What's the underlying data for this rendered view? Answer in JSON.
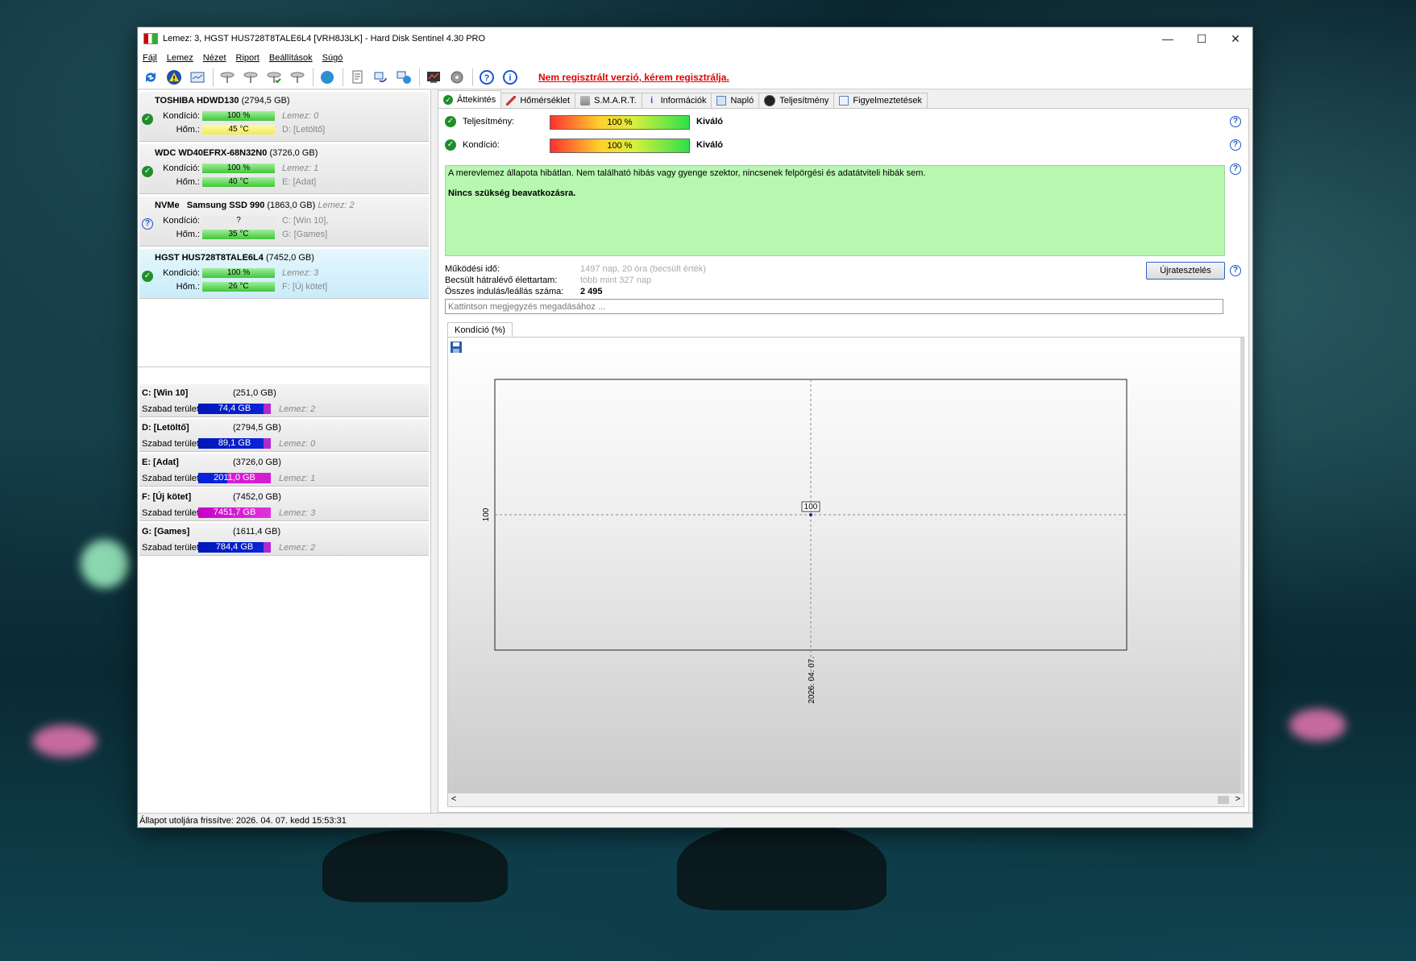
{
  "window": {
    "title": "Lemez: 3, HGST HUS728T8TALE6L4 [VRH8J3LK]  -  Hard Disk Sentinel 4.30 PRO",
    "minimize": "—",
    "maximize": "☐",
    "close": "✕"
  },
  "menu": [
    "Fájl",
    "Lemez",
    "Nézet",
    "Riport",
    "Beállítások",
    "Súgó"
  ],
  "toolbar": {
    "register_link": "Nem regisztrált verzió, kérem regisztrálja."
  },
  "disks": [
    {
      "model": "TOSHIBA HDWD130",
      "size": "(2794,5 GB)",
      "condition_label": "Kondíció:",
      "condition": "100 %",
      "condition_fill": 1.0,
      "temp_label": "Hőm.:",
      "temp": "45 °C",
      "disk_ref": "Lemez: 0",
      "volume_ref": "D: [Letöltő]",
      "status": "ok",
      "temp_color": "yellow"
    },
    {
      "model": "WDC WD40EFRX-68N32N0",
      "size": "(3726,0 GB)",
      "condition_label": "Kondíció:",
      "condition": "100 %",
      "condition_fill": 1.0,
      "temp_label": "Hőm.:",
      "temp": "40 °C",
      "disk_ref": "Lemez: 1",
      "volume_ref": "E: [Adat]",
      "status": "ok",
      "temp_color": "green"
    },
    {
      "prefix": "NVMe",
      "model": "Samsung SSD 990",
      "size": "(1863,0 GB)",
      "inline_ref": "Lemez: 2",
      "condition_label": "Kondíció:",
      "condition": "?",
      "temp_label": "Hőm.:",
      "temp": "35 °C",
      "volume_ref": "C: [Win 10],",
      "volume_ref2": "G: [Games]",
      "status": "unknown",
      "temp_color": "green"
    },
    {
      "model": "HGST HUS728T8TALE6L4",
      "size": "(7452,0 GB)",
      "condition_label": "Kondíció:",
      "condition": "100 %",
      "condition_fill": 1.0,
      "temp_label": "Hőm.:",
      "temp": "26 °C",
      "disk_ref": "Lemez: 3",
      "volume_ref": "F: [Új kötet]",
      "status": "ok",
      "temp_color": "green",
      "selected": true
    }
  ],
  "volumes": [
    {
      "name": "C: [Win 10]",
      "size": "(251,0 GB)",
      "free_label": "Szabad terület",
      "free": "74,4 GB",
      "disk": "Lemez: 2"
    },
    {
      "name": "D: [Letöltő]",
      "size": "(2794,5 GB)",
      "free_label": "Szabad terület",
      "free": "89,1 GB",
      "disk": "Lemez: 0"
    },
    {
      "name": "E: [Adat]",
      "size": "(3726,0 GB)",
      "free_label": "Szabad terület",
      "free": "2011,0 GB",
      "disk": "Lemez: 1"
    },
    {
      "name": "F: [Új kötet]",
      "size": "(7452,0 GB)",
      "free_label": "Szabad terület",
      "free": "7451,7 GB",
      "disk": "Lemez: 3"
    },
    {
      "name": "G: [Games]",
      "size": "(1611,4 GB)",
      "free_label": "Szabad terület",
      "free": "784,4 GB",
      "disk": "Lemez: 2"
    }
  ],
  "tabs": [
    "Áttekintés",
    "Hőmérséklet",
    "S.M.A.R.T.",
    "Információk",
    "Napló",
    "Teljesítmény",
    "Figyelmeztetések"
  ],
  "overview": {
    "performance_label": "Teljesítmény:",
    "performance_value": "100 %",
    "performance_verdict": "Kiváló",
    "condition_label": "Kondíció:",
    "condition_value": "100 %",
    "condition_verdict": "Kiváló",
    "status_text": "A merevlemez állapota hibátlan. Nem található hibás vagy gyenge szektor, nincsenek felpörgési és adatátviteli hibák sem.",
    "action_text": "Nincs szükség beavatkozásra.",
    "uptime_label": "Működési idő:",
    "uptime_value": "1497 nap, 20 óra (becsült érték)",
    "remaining_label": "Becsült hátralévő élettartam:",
    "remaining_value": "több mint 327 nap",
    "startstop_label": "Összes indulás/leállás száma:",
    "startstop_value": "2 495",
    "reset_button": "Újratesztelés",
    "note_placeholder": "Kattintson megjegyzés megadásához ...",
    "chart_tab": "Kondíció  (%)"
  },
  "chart_data": {
    "type": "scatter",
    "x": [
      "2026. 04. 07."
    ],
    "values": [
      100
    ],
    "data_labels": [
      "100"
    ],
    "y_tick": "100",
    "x_tick": "2026. 04. 07.",
    "grid": true
  },
  "statusbar": "Állapot utoljára frissítve: 2026. 04. 07. kedd 15:53:31",
  "colors": {
    "accent": "#1d55c8",
    "ok": "#1f8e2a",
    "status_bg": "#b7f7b0",
    "register": "#e00000"
  }
}
